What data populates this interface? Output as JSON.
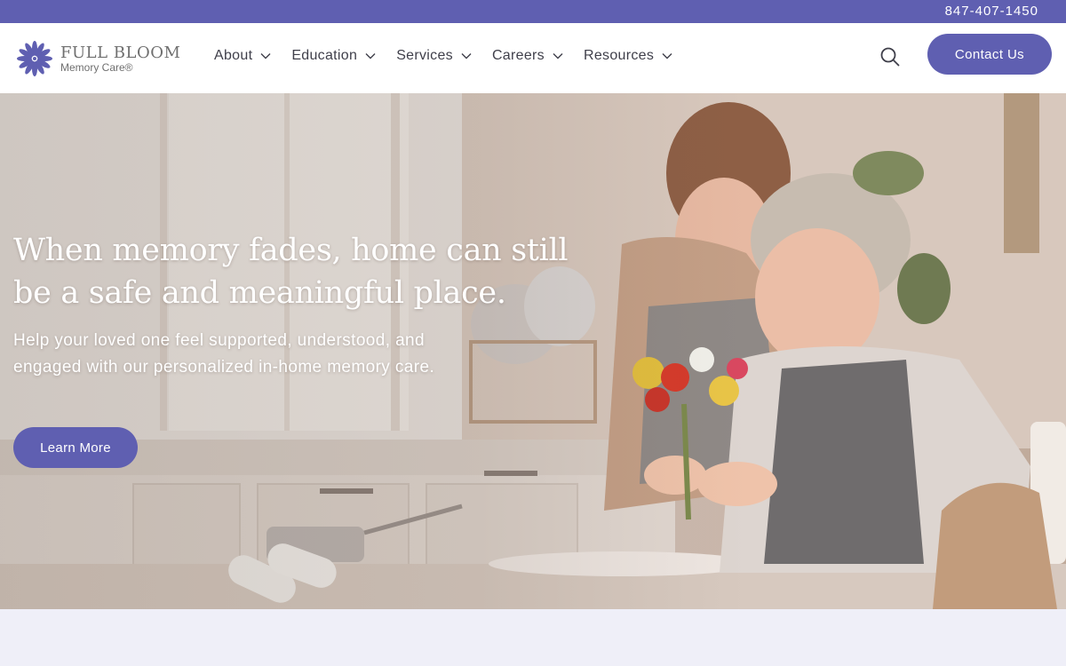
{
  "topbar": {
    "phone": "847-407-1450"
  },
  "brand": {
    "name": "FULL BLOOM",
    "sub": "Memory Care®",
    "color": "#5f5fb1"
  },
  "nav": {
    "items": [
      {
        "label": "About"
      },
      {
        "label": "Education"
      },
      {
        "label": "Services"
      },
      {
        "label": "Careers"
      },
      {
        "label": "Resources"
      }
    ]
  },
  "header": {
    "search_icon": "search-icon",
    "contact_label": "Contact Us"
  },
  "hero": {
    "headline_line1": "When memory fades, home can still",
    "headline_line2": "be a safe and meaningful place.",
    "subline_line1": "Help your loved one feel supported, understood, and",
    "subline_line2": "engaged with our personalized in-home memory care.",
    "cta_label": "Learn More"
  }
}
